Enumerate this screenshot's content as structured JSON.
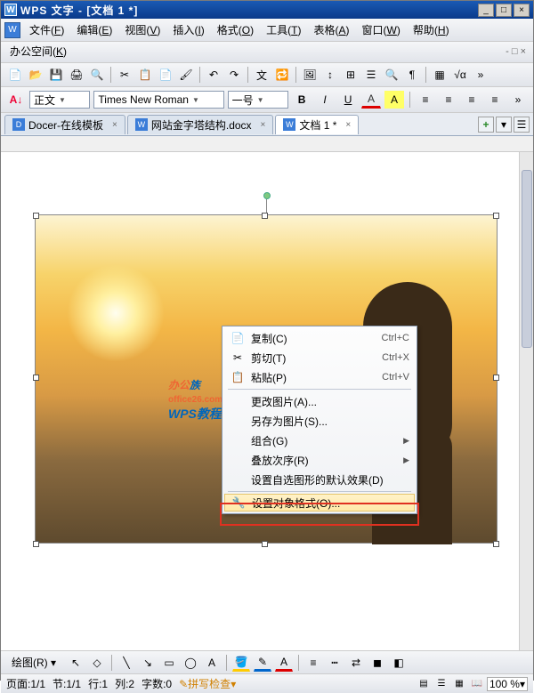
{
  "window": {
    "title": "WPS 文字 - [文档 1 *]",
    "min": "_",
    "max": "□",
    "close": "×"
  },
  "menubar": {
    "items": [
      {
        "label": "文件",
        "u": "F"
      },
      {
        "label": "编辑",
        "u": "E"
      },
      {
        "label": "视图",
        "u": "V"
      },
      {
        "label": "插入",
        "u": "I"
      },
      {
        "label": "格式",
        "u": "O"
      },
      {
        "label": "工具",
        "u": "T"
      },
      {
        "label": "表格",
        "u": "A"
      },
      {
        "label": "窗口",
        "u": "W"
      },
      {
        "label": "帮助",
        "u": "H"
      }
    ],
    "row2": {
      "label": "办公空间",
      "u": "K"
    },
    "sub_close": "- □ ×"
  },
  "format": {
    "style_prefix": "A↓",
    "style": "正文",
    "font": "Times New Roman",
    "size": "一号",
    "bold": "B",
    "italic": "I",
    "underline": "U",
    "color": "A",
    "hilite": "A"
  },
  "tabs": {
    "items": [
      {
        "label": "Docer-在线模板",
        "active": false,
        "icon": "D"
      },
      {
        "label": "网站金字塔结构.docx",
        "active": false,
        "icon": "W"
      },
      {
        "label": "文档 1 *",
        "active": true,
        "icon": "W"
      }
    ]
  },
  "context_menu": {
    "items": [
      {
        "icon": "📄",
        "label": "复制(C)",
        "shortcut": "Ctrl+C",
        "type": "item"
      },
      {
        "icon": "✂",
        "label": "剪切(T)",
        "shortcut": "Ctrl+X",
        "type": "item"
      },
      {
        "icon": "📋",
        "label": "粘贴(P)",
        "shortcut": "Ctrl+V",
        "type": "item"
      },
      {
        "type": "div"
      },
      {
        "icon": "",
        "label": "更改图片(A)...",
        "type": "item"
      },
      {
        "icon": "",
        "label": "另存为图片(S)...",
        "type": "item"
      },
      {
        "icon": "",
        "label": "组合(G)",
        "arrow": "▶",
        "type": "item"
      },
      {
        "icon": "",
        "label": "叠放次序(R)",
        "arrow": "▶",
        "type": "item"
      },
      {
        "icon": "",
        "label": "设置自选图形的默认效果(D)",
        "type": "item"
      },
      {
        "type": "div"
      },
      {
        "icon": "🔧",
        "label": "设置对象格式(O)...",
        "type": "item",
        "hl": true
      }
    ]
  },
  "watermark": {
    "line1a": "办公",
    "line1b": "族",
    "line2": "office26.com",
    "line3": "WPS教程"
  },
  "drawbar": {
    "label": "绘图(R)"
  },
  "status": {
    "page": "页面:1/1",
    "section": "节:1/1",
    "line": "行:1",
    "col": "列:2",
    "words": "字数:0",
    "spell": "拼写检查",
    "zoom": "100 %"
  }
}
